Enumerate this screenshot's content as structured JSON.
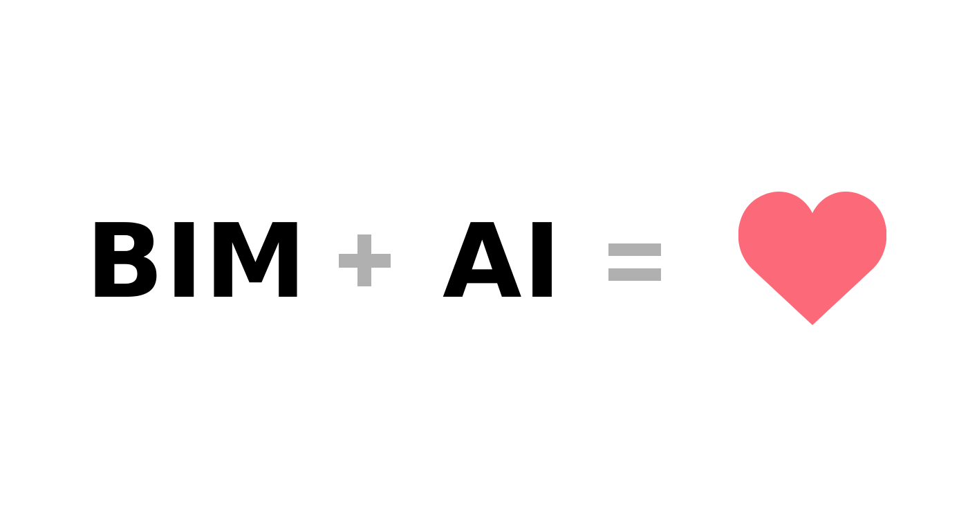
{
  "equation": {
    "term_1": "BIM",
    "operator_1": "+",
    "term_2": "AI",
    "operator_2": "=",
    "result_icon": "heart-icon"
  },
  "colors": {
    "background": "#ffffff",
    "text": "#000000",
    "operators": "#b0b0b0",
    "heart": "#fc6a7a"
  }
}
